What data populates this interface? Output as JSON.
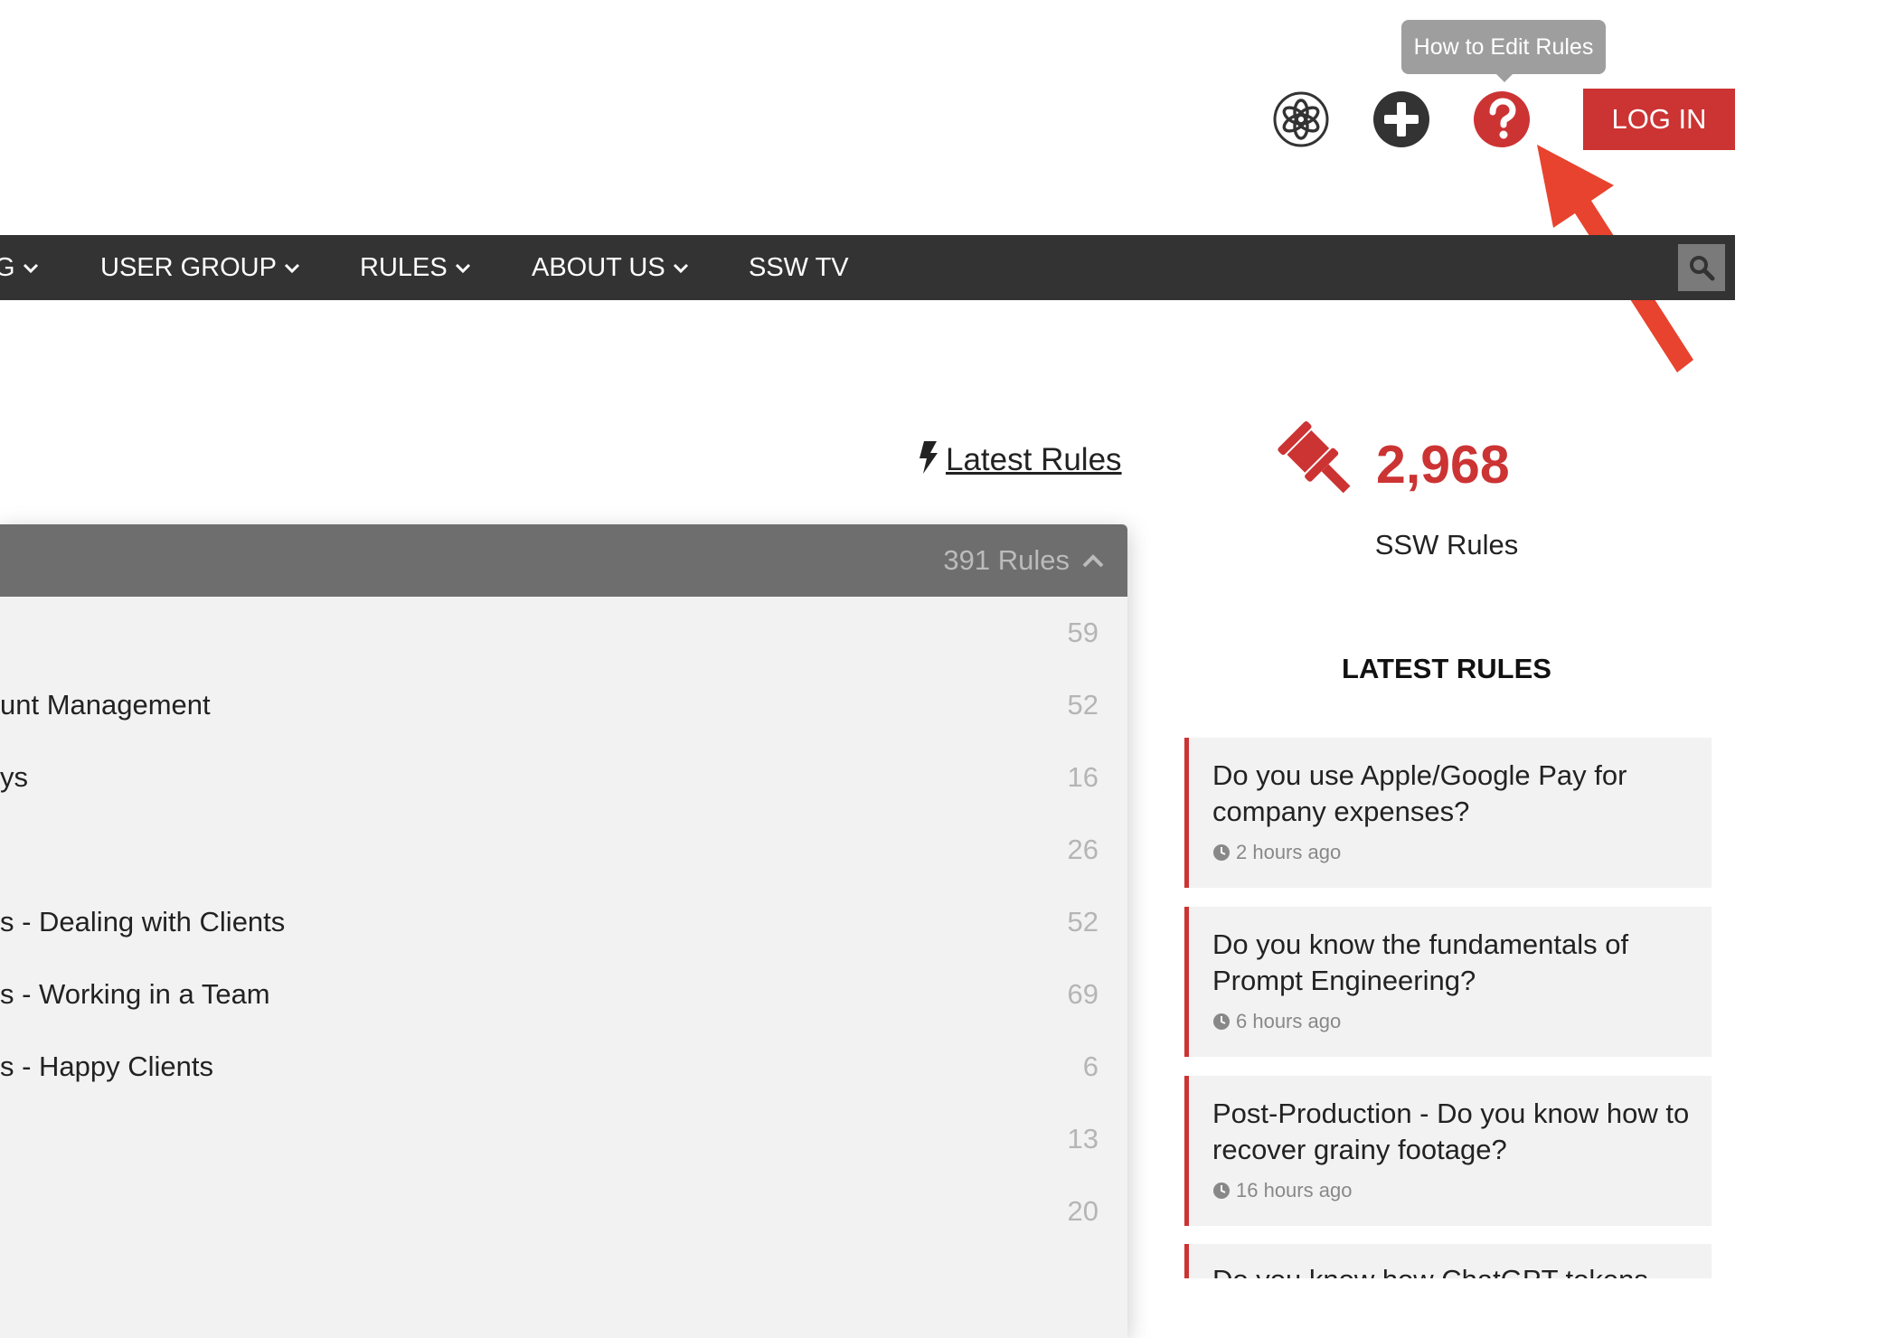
{
  "header": {
    "tooltip": "How to Edit Rules",
    "icons": [
      "chatgpt-icon",
      "add-icon",
      "help-icon"
    ],
    "login_label": "LOG IN"
  },
  "nav": {
    "items": [
      {
        "label": "G",
        "has_dropdown": true
      },
      {
        "label": "USER GROUP",
        "has_dropdown": true
      },
      {
        "label": "RULES",
        "has_dropdown": true
      },
      {
        "label": "ABOUT US",
        "has_dropdown": true
      },
      {
        "label": "SSW TV",
        "has_dropdown": false
      }
    ],
    "search_icon": "search-icon"
  },
  "latest_link": "Latest Rules",
  "panel": {
    "count_label": "391 Rules",
    "rows": [
      {
        "label": "",
        "count": "59"
      },
      {
        "label": "unt Management",
        "count": "52"
      },
      {
        "label": "ys",
        "count": "16"
      },
      {
        "label": "",
        "count": "26"
      },
      {
        "label": "s - Dealing with Clients",
        "count": "52"
      },
      {
        "label": "s - Working in a Team",
        "count": "69"
      },
      {
        "label": "s - Happy Clients",
        "count": "6"
      },
      {
        "label": "",
        "count": "13"
      },
      {
        "label": "",
        "count": "20"
      }
    ]
  },
  "stats": {
    "count": "2,968",
    "label": "SSW Rules"
  },
  "latest": {
    "heading": "LATEST RULES",
    "items": [
      {
        "title": "Do you use Apple/Google Pay for company expenses?",
        "time": "2 hours ago"
      },
      {
        "title": "Do you know the fundamentals of Prompt Engineering?",
        "time": "6 hours ago"
      },
      {
        "title": "Post-Production - Do you know how to recover grainy footage?",
        "time": "16 hours ago"
      },
      {
        "title": "Do you know how ChatGPT tokens",
        "time": ""
      }
    ]
  },
  "colors": {
    "brand_red": "#cc3333",
    "nav_bg": "#333333",
    "panel_head": "#6e6e6e",
    "panel_bg": "#f2f2f2",
    "annotation_arrow": "#e8432e"
  }
}
